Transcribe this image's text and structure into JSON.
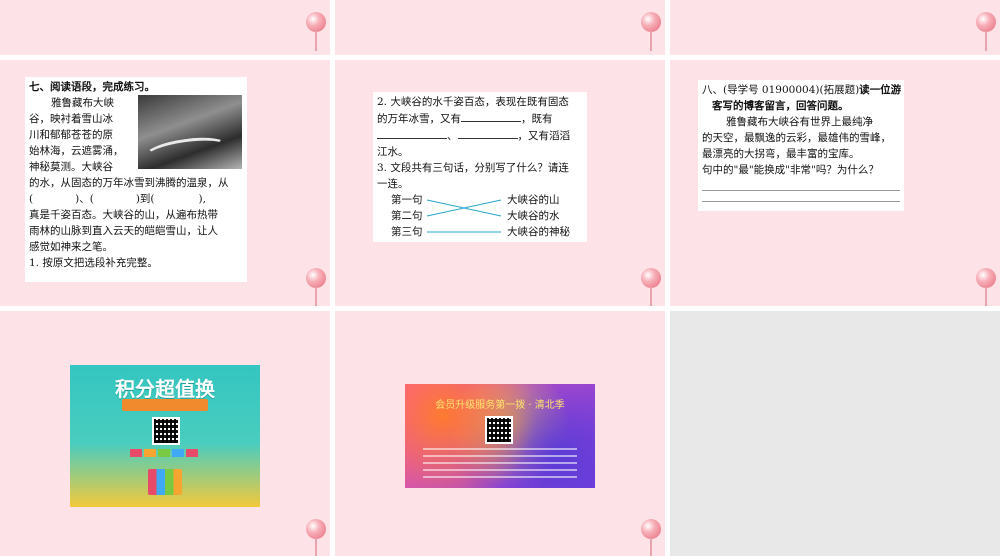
{
  "slide4": {
    "heading": "七、阅读语段，完成练习。",
    "lines_wrap": [
      "雅鲁藏布大峡",
      "谷，映衬着雪山冰",
      "川和郁郁苍苍的原",
      "始林海，云遮雾涌，",
      "神秘莫测。大峡谷"
    ],
    "line6": "的水，从固态的万年冰雪到沸腾的温泉，从",
    "blank_a": "(",
    "blank_b": ")、(",
    "blank_c": ")到(",
    "blank_d": "),",
    "line8": "真是千姿百态。大峡谷的山，从遍布热带",
    "line9": "雨林的山脉到直入云天的皑皑雪山，让人",
    "line10": "感觉如神来之笔。",
    "q1": "1. 按原文把选段补充完整。"
  },
  "slide5": {
    "q2_l1": "2. 大峡谷的水千姿百态，表现在既有固态",
    "q2_l2a": "的万年冰雪，又有",
    "q2_l2b": "，既有",
    "q2_l3a": "、",
    "q2_l3b": "，又有滔滔",
    "q2_l4": "江水。",
    "q3_l1": "3. 文段共有三句话，分别写了什么？请连",
    "q3_l2": "一连。",
    "left": [
      "第一句",
      "第二句",
      "第三句"
    ],
    "right": [
      "大峡谷的山",
      "大峡谷的水",
      "大峡谷的神秘"
    ]
  },
  "slide6": {
    "title_a": "八、(导学号 01900004)(拓展题)",
    "title_b": "读一位游",
    "title_c": "客写的博客留言，回答问题。",
    "p1": "雅鲁藏布大峡谷有世界上最纯净",
    "p2": "的天空，最飘逸的云彩，最雄伟的雪峰，",
    "p3": "最漂亮的大拐弯，最丰富的宝库。",
    "q": "句中的\"最\"能换成\"非常\"吗？为什么？"
  },
  "promo1": {
    "title": "积分超值换"
  },
  "promo2": {
    "title": "会员升级服务第一拨 · 清北季"
  },
  "colors": {
    "slide_bg": "#fde3e7",
    "line_color": "#2aa7c9",
    "teal": "#34c6c0",
    "yellow": "#f3c93b"
  },
  "icons": [
    "pushpin-icon",
    "qr-code-icon"
  ]
}
